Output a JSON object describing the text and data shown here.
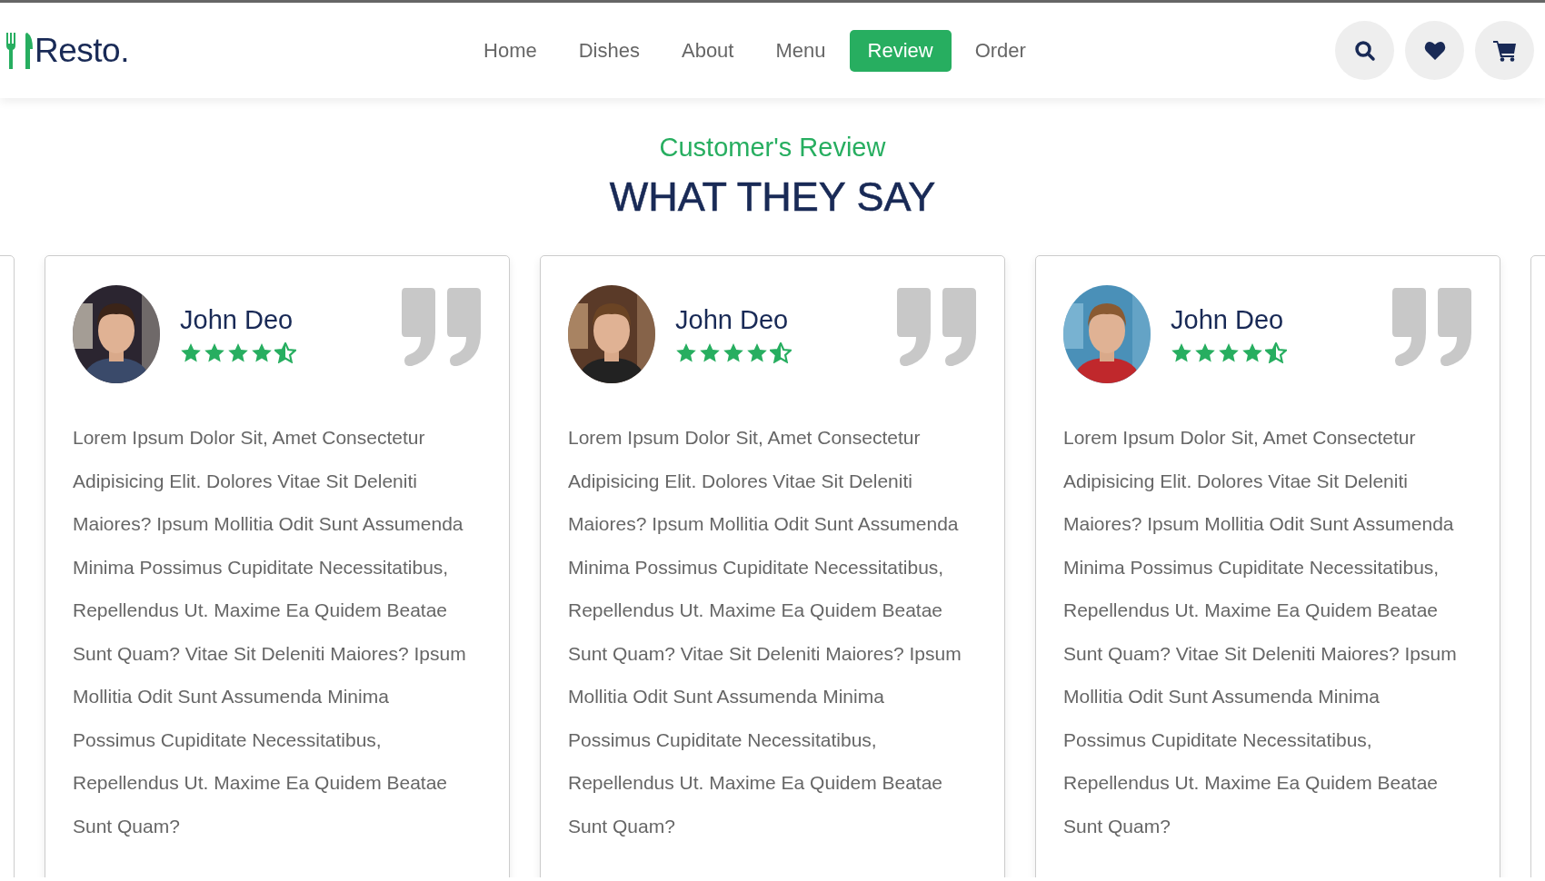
{
  "header": {
    "logo": "Resto.",
    "nav": [
      {
        "label": "Home",
        "selected": false
      },
      {
        "label": "Dishes",
        "selected": false
      },
      {
        "label": "About",
        "selected": false
      },
      {
        "label": "Menu",
        "selected": false
      },
      {
        "label": "Review",
        "selected": true
      },
      {
        "label": "Order",
        "selected": false
      }
    ]
  },
  "section": {
    "subtitle": "Customer's Review",
    "title": "WHAT THEY SAY"
  },
  "reviews": [
    {
      "name": "John Deo",
      "stars": 4.5,
      "text": "Lorem Ipsum Dolor Sit, Amet Consectetur Adipisicing Elit. Dolores Vitae Sit Deleniti Maiores? Ipsum Mollitia Odit Sunt Assumenda Minima Possimus Cupiditate Necessitatibus, Repellendus Ut. Maxime Ea Quidem Beatae Sunt Quam? Vitae Sit Deleniti Maiores? Ipsum Mollitia Odit Sunt Assumenda Minima Possimus Cupiditate Necessitatibus, Repellendus Ut. Maxime Ea Quidem Beatae Sunt Quam?"
    },
    {
      "name": "John Deo",
      "stars": 4.5,
      "text": "Lorem Ipsum Dolor Sit, Amet Consectetur Adipisicing Elit. Dolores Vitae Sit Deleniti Maiores? Ipsum Mollitia Odit Sunt Assumenda Minima Possimus Cupiditate Necessitatibus, Repellendus Ut. Maxime Ea Quidem Beatae Sunt Quam? Vitae Sit Deleniti Maiores? Ipsum Mollitia Odit Sunt Assumenda Minima Possimus Cupiditate Necessitatibus, Repellendus Ut. Maxime Ea Quidem Beatae Sunt Quam?"
    },
    {
      "name": "John Deo",
      "stars": 4.5,
      "text": "Lorem Ipsum Dolor Sit, Amet Consectetur Adipisicing Elit. Dolores Vitae Sit Deleniti Maiores? Ipsum Mollitia Odit Sunt Assumenda Minima Possimus Cupiditate Necessitatibus, Repellendus Ut. Maxime Ea Quidem Beatae Sunt Quam? Vitae Sit Deleniti Maiores? Ipsum Mollitia Odit Sunt Assumenda Minima Possimus Cupiditate Necessitatibus, Repellendus Ut. Maxime Ea Quidem Beatae Sunt Quam?"
    }
  ]
}
